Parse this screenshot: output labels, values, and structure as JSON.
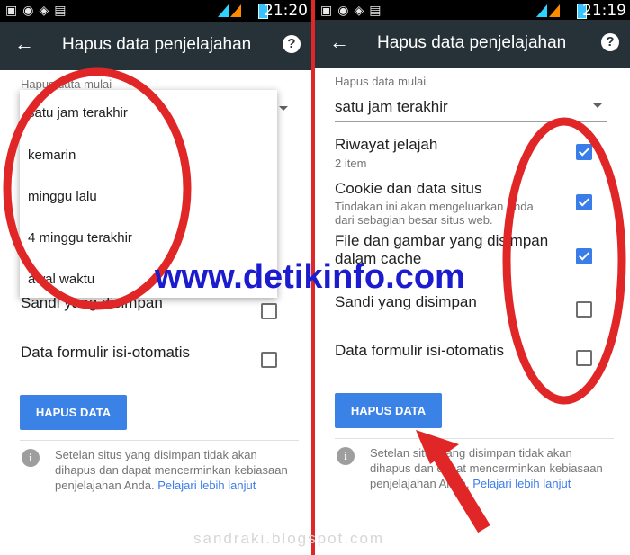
{
  "left": {
    "status_time": "21:20",
    "title": "Hapus data penjelajahan",
    "time_range_label": "Hapus data mulai",
    "time_range_options": [
      "satu jam terakhir",
      "kemarin",
      "minggu lalu",
      "4 minggu terakhir",
      "awal waktu"
    ],
    "rows": [
      {
        "title": "Sandi yang disimpan",
        "checked": false
      },
      {
        "title": "Data formulir isi-otomatis",
        "checked": false
      }
    ],
    "button_label": "HAPUS DATA",
    "info_text": "Setelan situs yang disimpan tidak akan dihapus dan dapat mencerminkan kebiasaan penjelajahan Anda.",
    "info_link": "Pelajari lebih lanjut"
  },
  "right": {
    "status_time": "21:19",
    "title": "Hapus data penjelajahan",
    "time_range_label": "Hapus data mulai",
    "time_range_value": "satu jam terakhir",
    "rows": [
      {
        "title": "Riwayat jelajah",
        "subtitle": "2 item",
        "checked": true
      },
      {
        "title": "Cookie dan data situs",
        "subtitle": "Tindakan ini akan mengeluarkan Anda dari sebagian besar situs web.",
        "checked": true
      },
      {
        "title": "File dan gambar yang disimpan dalam cache",
        "subtitle": "",
        "checked": true
      },
      {
        "title": "Sandi yang disimpan",
        "subtitle": "",
        "checked": false
      },
      {
        "title": "Data formulir isi-otomatis",
        "subtitle": "",
        "checked": false
      }
    ],
    "button_label": "HAPUS DATA",
    "info_text": "Setelan situs yang disimpan tidak akan dihapus dan dapat mencerminkan kebiasaan penjelajahan Anda.",
    "info_link": "Pelajari lebih lanjut"
  },
  "watermark": "www.detikinfo.com",
  "watermark_bottom": "sandraki.blogspot.com",
  "colors": {
    "appbar": "#263238",
    "accent": "#3b82e6",
    "annotation": "#e02626",
    "watermark": "#1c1ccf"
  }
}
